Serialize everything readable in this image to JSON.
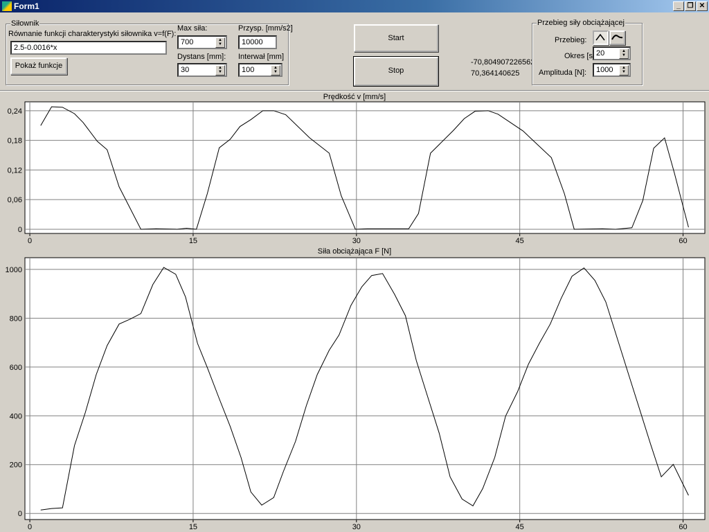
{
  "window": {
    "title": "Form1",
    "controls": [
      "_",
      "❐",
      "✕"
    ]
  },
  "silownik": {
    "group_label": "Siłownik",
    "equation_label": "Równanie funkcji charakterystyki siłownika v=f(F):",
    "equation_value": "2.5-0.0016*x",
    "show_button": "Pokaż funkcje"
  },
  "params": {
    "max_sila_label": "Max siła:",
    "max_sila_value": "700",
    "przysp_label": "Przysp. [mm/s2]",
    "przysp_value": "10000",
    "dystans_label": "Dystans [mm]:",
    "dystans_value": "30",
    "interwal_label": "Interwał [mm]",
    "interwal_value": "100"
  },
  "buttons": {
    "start": "Start",
    "stop": "Stop"
  },
  "readout": {
    "line1": "-70,8049072265625",
    "line2": "70,364140625"
  },
  "przebieg": {
    "group_label": "Przebieg siły obciążającej",
    "przebieg_label": "Przebieg:",
    "waveforms": [
      "triangle-icon",
      "sine-icon"
    ],
    "selected_waveform": "triangle",
    "okres_label": "Okres [s]:",
    "okres_value": "20",
    "amplituda_label": "Amplituda [N]:",
    "amplituda_value": "1000"
  },
  "chart_data": [
    {
      "type": "line",
      "title": "Prędkość v [mm/s]",
      "xlim": [
        -0.45,
        62
      ],
      "ylim": [
        -0.0085,
        0.258
      ],
      "grid": true,
      "xticks": [
        0,
        15,
        30,
        45,
        60
      ],
      "yticks": [
        0,
        0.06,
        0.12,
        0.18,
        0.24
      ],
      "ytick_labels": [
        "0",
        "0,06",
        "0,12",
        "0,18",
        "0,24"
      ],
      "x": [
        1,
        2,
        3,
        4.1,
        4.9,
        6.2,
        7.1,
        8.2,
        10.2,
        11.6,
        13.5,
        14.4,
        15.3,
        16.3,
        17.4,
        18.4,
        19.3,
        20.3,
        21.4,
        22.4,
        23.5,
        25.7,
        27.5,
        28.6,
        29.9,
        31,
        34.8,
        35.7,
        36.8,
        38.9,
        39.9,
        40.9,
        42.1,
        43,
        45.3,
        47.9,
        49.1,
        50,
        52.6,
        53.8,
        55.3,
        56.3,
        57.3,
        58.3,
        59.2,
        60.5
      ],
      "y": [
        0.21,
        0.248,
        0.247,
        0.234,
        0.216,
        0.178,
        0.161,
        0.086,
        0,
        0.001,
        0,
        0.002,
        0,
        0.072,
        0.165,
        0.182,
        0.208,
        0.222,
        0.24,
        0.24,
        0.232,
        0.185,
        0.154,
        0.068,
        0,
        0.001,
        0.001,
        0.032,
        0.154,
        0.2,
        0.224,
        0.239,
        0.24,
        0.233,
        0.199,
        0.145,
        0.072,
        0,
        0.001,
        0,
        0.003,
        0.058,
        0.164,
        0.185,
        0.114,
        0.004
      ]
    },
    {
      "type": "line",
      "title": "Siła obciążająca F [N]",
      "xlim": [
        -0.45,
        62
      ],
      "ylim": [
        -25,
        1048
      ],
      "grid": true,
      "xticks": [
        0,
        15,
        30,
        45,
        60
      ],
      "yticks": [
        0,
        200,
        400,
        600,
        800,
        1000
      ],
      "ytick_labels": [
        "0",
        "200",
        "400",
        "600",
        "800",
        "1000"
      ],
      "x": [
        1,
        2,
        3,
        4.1,
        5.1,
        6.1,
        7.1,
        8.2,
        9.2,
        10.2,
        11.3,
        12.3,
        13.4,
        14.3,
        15.4,
        16.3,
        17.4,
        18.4,
        19.4,
        20.3,
        21.3,
        22.4,
        23.3,
        24.4,
        25.4,
        26.4,
        27.5,
        28.4,
        29.5,
        30.5,
        31.4,
        32.4,
        33.5,
        34.5,
        35.5,
        36.6,
        37.6,
        38.6,
        39.7,
        40.7,
        41.6,
        42.7,
        43.7,
        44.8,
        45.8,
        46.8,
        47.8,
        48.8,
        49.8,
        50.9,
        51.9,
        52.9,
        54,
        55,
        56,
        57,
        58,
        59.1,
        60.5
      ],
      "y": [
        14,
        20,
        23,
        278,
        414,
        569,
        688,
        776,
        796,
        819,
        938,
        1008,
        980,
        887,
        697,
        598,
        470,
        357,
        229,
        88,
        34,
        65,
        173,
        295,
        442,
        569,
        669,
        731,
        853,
        929,
        975,
        983,
        898,
        810,
        626,
        470,
        329,
        150,
        59,
        31,
        102,
        229,
        399,
        499,
        612,
        697,
        776,
        881,
        972,
        1006,
        955,
        867,
        711,
        569,
        428,
        286,
        150,
        201,
        74
      ]
    }
  ]
}
